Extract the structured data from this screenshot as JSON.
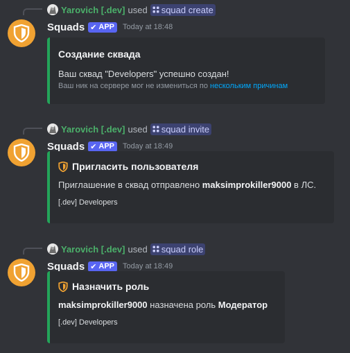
{
  "messages": [
    {
      "reply": {
        "user": "Yarovich [.dev]",
        "used": "used",
        "command": "squad create"
      },
      "bot": {
        "name": "Squads",
        "tag": "APP",
        "time": "Today at 18:48"
      },
      "embed": {
        "title": "Создание сквада",
        "desc": "Ваш сквад \"Developers\" успешно создан!",
        "note_prefix": "Ваш ник на сервере мог не измениться по ",
        "note_link": "нескольким причинам"
      }
    },
    {
      "reply": {
        "user": "Yarovich [.dev]",
        "used": "used",
        "command": "squad invite"
      },
      "bot": {
        "name": "Squads",
        "tag": "APP",
        "time": "Today at 18:49"
      },
      "embed": {
        "title": "Пригласить пользователя",
        "desc_prefix": "Приглашение в сквад отправлено ",
        "desc_bold": "maksimprokiller9000",
        "desc_suffix": " в ЛС.",
        "footer": "[.dev] Developers"
      }
    },
    {
      "reply": {
        "user": "Yarovich [.dev]",
        "used": "used",
        "command": "squad role"
      },
      "bot": {
        "name": "Squads",
        "tag": "APP",
        "time": "Today at 18:49"
      },
      "embed": {
        "title": "Назначить роль",
        "desc_bold1": "maksimprokiller9000",
        "desc_mid": " назначена роль ",
        "desc_bold2": "Модератор",
        "footer": "[.dev] Developers"
      }
    }
  ],
  "colors": {
    "background": "#313338",
    "embed_bg": "#2b2d31",
    "embed_accent": "#23a55a",
    "avatar": "#f0a232",
    "app_tag": "#5865f2",
    "username_green": "#4bb06a",
    "link": "#00a8fc"
  },
  "icons": {
    "bot_avatar": "shield-icon",
    "command": "slash-command-icon",
    "embed_title": "shield-icon",
    "reply_avatar": "user-avatar"
  }
}
